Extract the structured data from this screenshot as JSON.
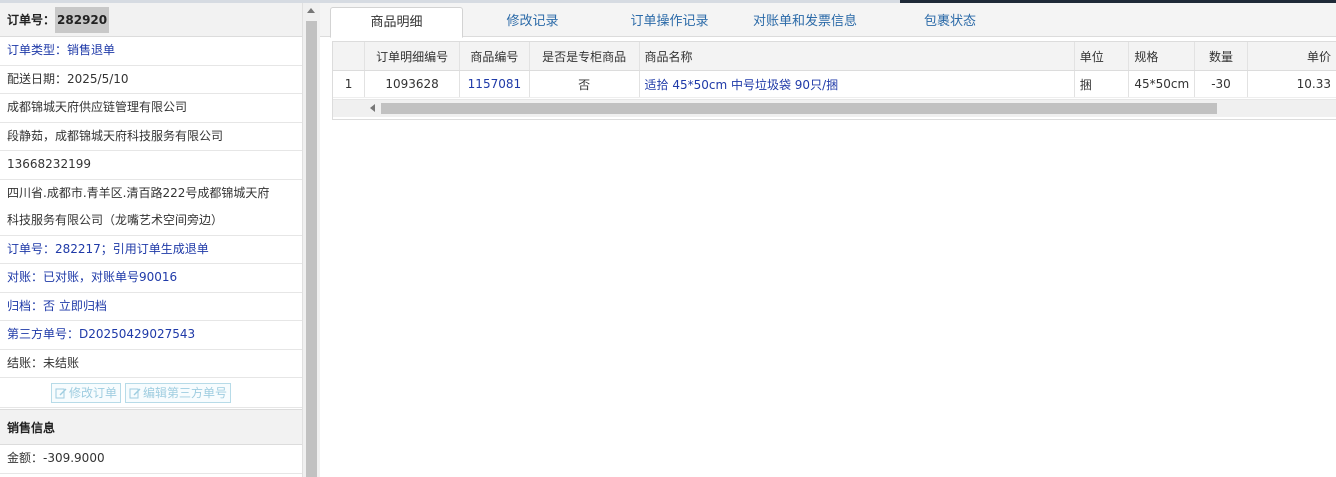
{
  "order_header": {
    "label": "订单号：",
    "number": "282920"
  },
  "info_rows": [
    {
      "text": "订单类型：销售退单",
      "style": "blue"
    },
    {
      "text": "配送日期：2025/5/10",
      "style": "dark"
    },
    {
      "text": "成都锦城天府供应链管理有限公司",
      "style": "dark"
    },
    {
      "text": "段静茹，成都锦城天府科技服务有限公司",
      "style": "dark"
    },
    {
      "text": "13668232199",
      "style": "dark"
    },
    {
      "text": "四川省.成都市.青羊区.清百路222号成都锦城天府",
      "style": "dark"
    },
    {
      "text": "科技服务有限公司（龙嘴艺术空间旁边）",
      "style": "dark"
    },
    {
      "text": "订单号：282217；引用订单生成退单",
      "style": "blue"
    },
    {
      "text": "对账：已对账，对账单号90016",
      "style": "blue"
    },
    {
      "text": "归档：否 立即归档",
      "style": "blue"
    },
    {
      "text": "第三方单号：D20250429027543",
      "style": "blue"
    },
    {
      "text": "结账：未结账",
      "style": "dark"
    }
  ],
  "buttons": {
    "edit_order": "修改订单",
    "edit_third_party": "编辑第三方单号"
  },
  "sales_section": {
    "title": "销售信息",
    "amount": "金额：-309.9000"
  },
  "tabs": [
    "商品明细",
    "修改记录",
    "订单操作记录",
    "对账单和发票信息",
    "包裹状态"
  ],
  "active_tab": 0,
  "table": {
    "columns": [
      "",
      "订单明细编号",
      "商品编号",
      "是否是专柜商品",
      "商品名称",
      "单位",
      "规格",
      "数量",
      "单价"
    ],
    "rows": [
      [
        "1",
        "1093628",
        "1157081",
        "否",
        "适拾 45*50cm 中号垃圾袋 90只/捆",
        "捆",
        "45*50cm",
        "-30",
        "10.33"
      ]
    ]
  }
}
